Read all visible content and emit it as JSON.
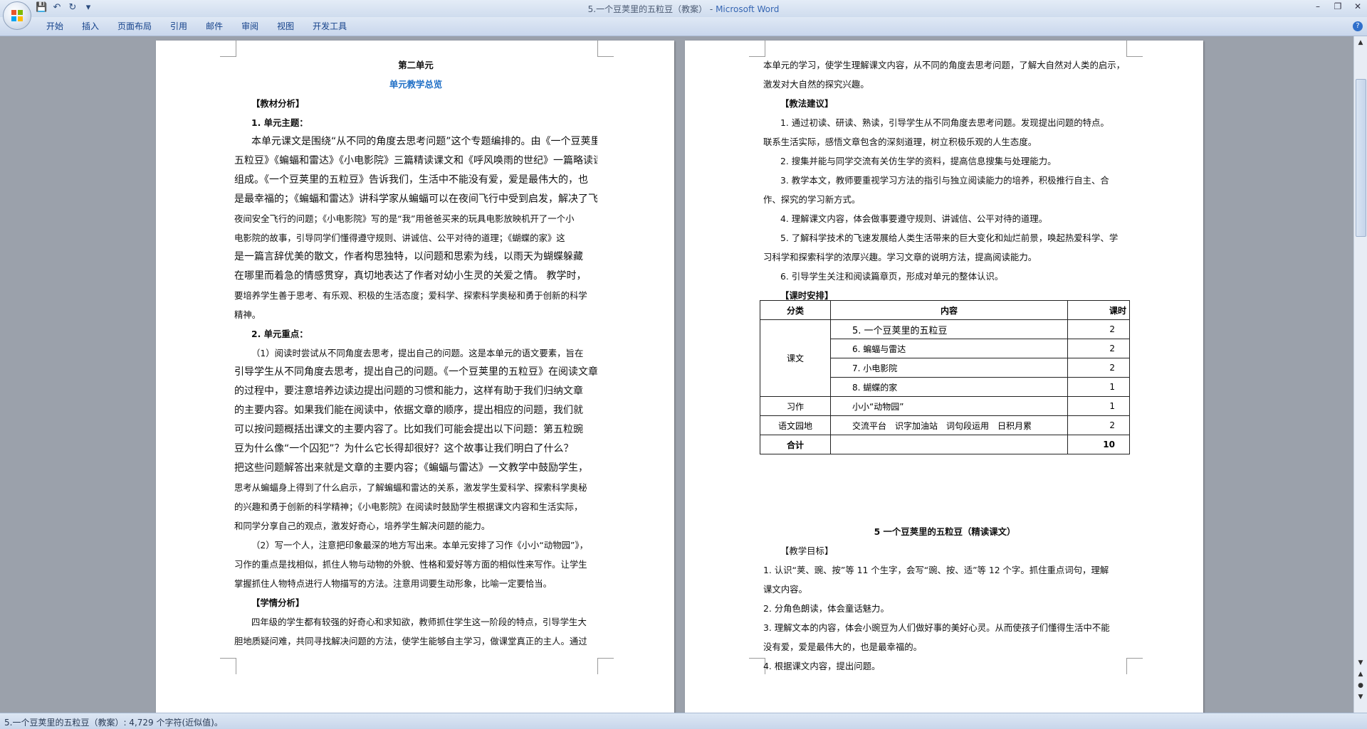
{
  "window": {
    "title": "5.一个豆荚里的五粒豆（教案）",
    "app_name": "Microsoft Word",
    "title_sep": " - "
  },
  "quick_access": {
    "save_icon": "save-icon",
    "undo_icon": "undo-icon",
    "redo_icon": "redo-icon",
    "customize_icon": "dropdown-icon"
  },
  "ribbon": {
    "tabs": [
      "开始",
      "插入",
      "页面布局",
      "引用",
      "邮件",
      "审阅",
      "视图",
      "开发工具"
    ]
  },
  "page1": {
    "lines": [
      "第二单元",
      "单元教学总览",
      "【教材分析】",
      "1. 单元主题：",
      "本单元课文是围绕“从不同的角度去思考问题”这个专题编排的。由《一个豆荚里的",
      "五粒豆》《蝙蝠和雷达》《小电影院》三篇精读课文和《呼风唤雨的世纪》一篇略读课文",
      "组成。《一个豆荚里的五粒豆》告诉我们，生活中不能没有爱，爱是最伟大的，也",
      "是最幸福的；《蝙蝠和雷达》讲科学家从蝙蝠可以在夜间飞行中受到启发，解决了飞机在",
      "夜间安全飞行的问题；《小电影院》写的是“我”用爸爸买来的玩具电影放映机开了一个小",
      "电影院的故事，引导同学们懂得遵守规则、讲诚信、公平对待的道理；《蝴蝶的家》这",
      "是一篇言辞优美的散文，作者构思独特，以问题和思索为线，以雨天为蝴蝶躲藏",
      "在哪里而着急的情感贯穿，真切地表达了作者对幼小生灵的关爱之情。 教学时，",
      "要培养学生善于思考、有乐观、积极的生活态度；爱科学、探索科学奥秘和勇于创新的科学",
      "精神。",
      "2. 单元重点：",
      "（1）阅读时尝试从不同角度去思考，提出自己的问题。这是本单元的语文要素，旨在",
      "引导学生从不同角度去思考，提出自己的问题。《一个豆荚里的五粒豆》在阅读文章",
      "的过程中，要注意培养边读边提出问题的习惯和能力，这样有助于我们归纳文章",
      "的主要内容。如果我们能在阅读中，依据文章的顺序，提出相应的问题，我们就",
      "可以按问题概括出课文的主要内容了。比如我们可能会提出以下问题：第五粒豌",
      "豆为什么像“一个囚犯”？为什么它长得却很好？这个故事让我们明白了什么？",
      "把这些问题解答出来就是文章的主要内容；《蝙蝠与雷达》一文教学中鼓励学生，",
      "思考从蝙蝠身上得到了什么启示，了解蝙蝠和雷达的关系，激发学生爱科学、探索科学奥秘",
      "的兴趣和勇于创新的科学精神；《小电影院》在阅读时鼓励学生根据课文内容和生活实际，",
      "和同学分享自己的观点，激发好奇心，培养学生解决问题的能力。",
      "（2）写一个人，注意把印象最深的地方写出来。本单元安排了习作《小小“动物园”》，",
      "习作的重点是找相似，抓住人物与动物的外貌、性格和爱好等方面的相似性来写作。让学生",
      "掌握抓住人物特点进行人物描写的方法。注意用词要生动形象，比喻一定要恰当。",
      "【学情分析】",
      "四年级的学生都有较强的好奇心和求知欲，教师抓住学生这一阶段的特点，引导学生大",
      "胆地质疑问难，共同寻找解决问题的方法，使学生能够自主学习，做课堂真正的主人。通过"
    ]
  },
  "page2": {
    "lines_top": [
      "本单元的学习，使学生理解课文内容，从不同的角度去思考问题，了解大自然对人类的启示，",
      "激发对大自然的探究兴趣。",
      "【教法建议】",
      "1. 通过初读、研读、熟读，引导学生从不同角度去思考问题。发现提出问题的特点。",
      "联系生活实际，感悟文章包含的深刻道理，树立积极乐观的人生态度。",
      "2. 搜集并能与同学交流有关仿生学的资料，提高信息搜集与处理能力。",
      "3. 教学本文，教师要重视学习方法的指引与独立阅读能力的培养，积极推行自主、合",
      "作、探究的学习新方式。",
      "4. 理解课文内容，体会做事要遵守规则、讲诚信、公平对待的道理。",
      "5. 了解科学技术的飞速发展给人类生活带来的巨大变化和灿烂前景，唤起热爱科学、学",
      "习科学和探索科学的浓厚兴趣。学习文章的说明方法，提高阅读能力。",
      "6. 引导学生关注和阅读篇章页，形成对单元的整体认识。",
      "【课时安排】"
    ],
    "table": {
      "headers": [
        "分类",
        "内容",
        "课时"
      ],
      "group_kewen": "课文",
      "kewen_rows": [
        {
          "content": "5. 一个豆荚里的五粒豆",
          "hours": "2"
        },
        {
          "content": "6. 蝙蝠与雷达",
          "hours": "2"
        },
        {
          "content": "7. 小电影院",
          "hours": "2"
        },
        {
          "content": "8. 蝴蝶的家",
          "hours": "1"
        }
      ],
      "xizuo": {
        "category": "习作",
        "content": "小小“动物园”",
        "hours": "1"
      },
      "yuwen": {
        "category": "语文园地",
        "content": "交流平台　识字加油站　词句段运用　日积月累",
        "hours": "2"
      },
      "total": {
        "category": "合计",
        "content": "",
        "hours": "10"
      }
    },
    "lines_bottom": [
      "5 一个豆荚里的五粒豆（精读课文）",
      "【教学目标】",
      "1. 认识“荚、豌、按”等 11 个生字，会写“豌、按、适”等 12 个字。抓住重点词句，理解",
      "课文内容。",
      "2. 分角色朗读，体会童话魅力。",
      "3. 理解文本的内容，体会小豌豆为人们做好事的美好心灵。从而使孩子们懂得生活中不能",
      "没有爱，爱是最伟大的，也是最幸福的。",
      "4. 根据课文内容，提出问题。"
    ]
  },
  "statusbar": {
    "text": "5.一个豆荚里的五粒豆（教案）: 4,729 个字符(近似值)。"
  },
  "colors": {
    "accent": "#1f6fc6",
    "ribbon_text": "#15428b"
  }
}
